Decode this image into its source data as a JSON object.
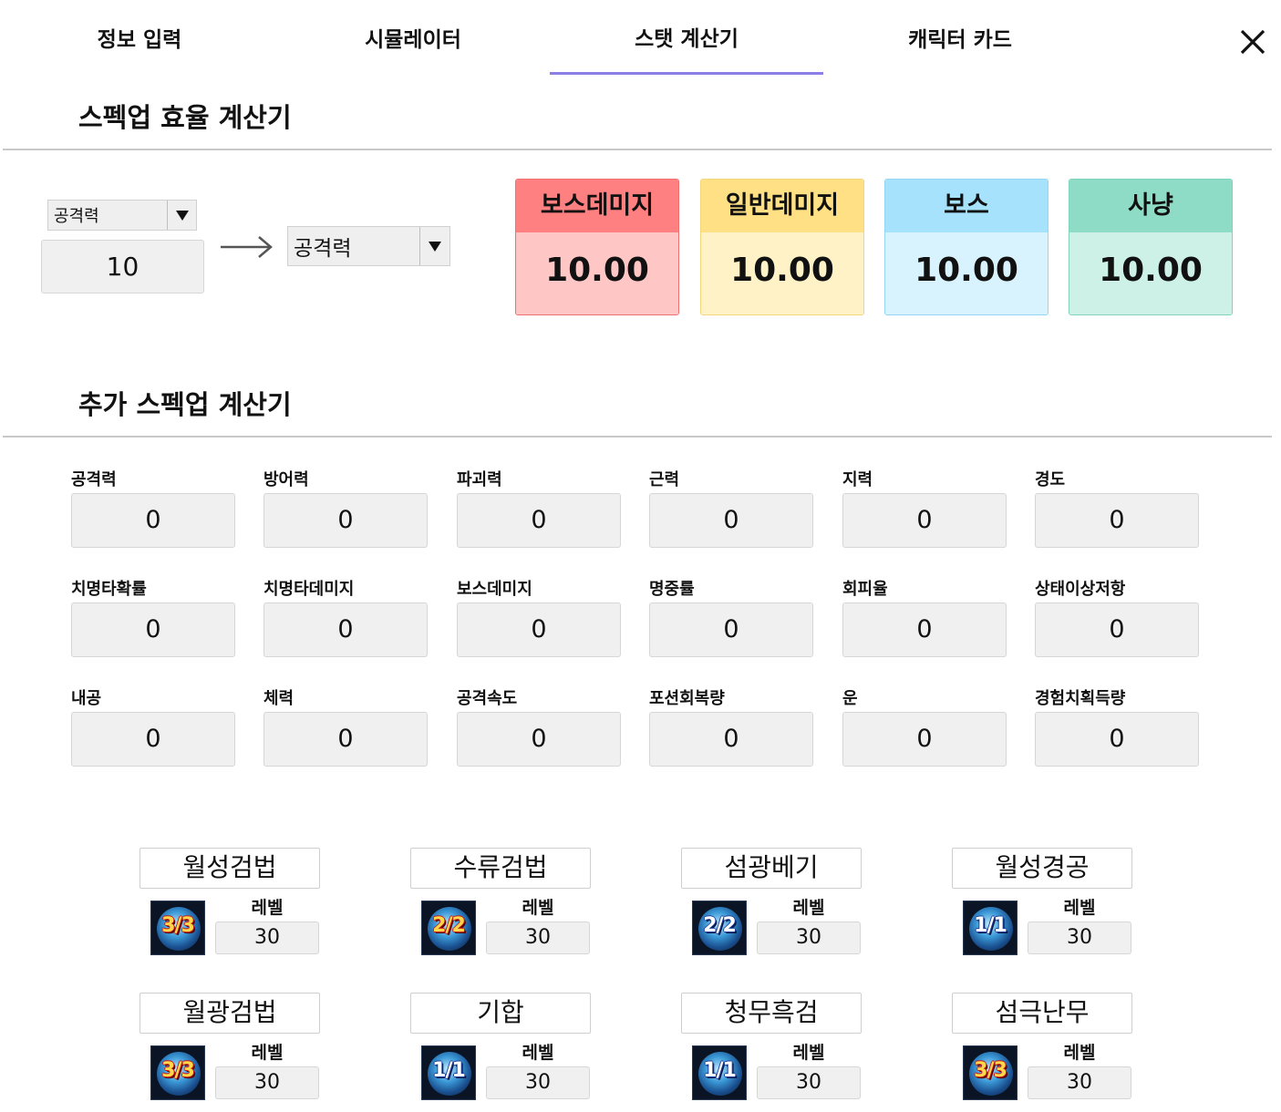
{
  "tabs": [
    {
      "label": "정보 입력"
    },
    {
      "label": "시뮬레이터"
    },
    {
      "label": "스탯 계산기"
    },
    {
      "label": "캐릭터 카드"
    }
  ],
  "active_tab": "스탯 계산기",
  "efficiency": {
    "title": "스펙업 효율 계산기",
    "from_stat": "공격력",
    "amount": "10",
    "to_stat": "공격력",
    "results": [
      {
        "label": "보스데미지",
        "value": "10.00"
      },
      {
        "label": "일반데미지",
        "value": "10.00"
      },
      {
        "label": "보스",
        "value": "10.00"
      },
      {
        "label": "사냥",
        "value": "10.00"
      }
    ]
  },
  "additional": {
    "title": "추가 스펙업 계산기",
    "stats": [
      {
        "label": "공격력",
        "value": "0"
      },
      {
        "label": "방어력",
        "value": "0"
      },
      {
        "label": "파괴력",
        "value": "0"
      },
      {
        "label": "근력",
        "value": "0"
      },
      {
        "label": "지력",
        "value": "0"
      },
      {
        "label": "경도",
        "value": "0"
      },
      {
        "label": "치명타확률",
        "value": "0"
      },
      {
        "label": "치명타데미지",
        "value": "0"
      },
      {
        "label": "보스데미지",
        "value": "0"
      },
      {
        "label": "명중률",
        "value": "0"
      },
      {
        "label": "회피율",
        "value": "0"
      },
      {
        "label": "상태이상저항",
        "value": "0"
      },
      {
        "label": "내공",
        "value": "0"
      },
      {
        "label": "체력",
        "value": "0"
      },
      {
        "label": "공격속도",
        "value": "0"
      },
      {
        "label": "포션회복량",
        "value": "0"
      },
      {
        "label": "운",
        "value": "0"
      },
      {
        "label": "경험치획득량",
        "value": "0"
      }
    ]
  },
  "skills": [
    {
      "name": "월성검법",
      "icon_text": "3/3",
      "level_label": "레벨",
      "level": "30"
    },
    {
      "name": "수류검법",
      "icon_text": "2/2",
      "level_label": "레벨",
      "level": "30"
    },
    {
      "name": "섬광베기",
      "icon_text": "2/2",
      "level_label": "레벨",
      "level": "30"
    },
    {
      "name": "월성경공",
      "icon_text": "1/1",
      "level_label": "레벨",
      "level": "30"
    },
    {
      "name": "월광검법",
      "icon_text": "3/3",
      "level_label": "레벨",
      "level": "30"
    },
    {
      "name": "기합",
      "icon_text": "1/1",
      "level_label": "레벨",
      "level": "30"
    },
    {
      "name": "청무흑검",
      "icon_text": "1/1",
      "level_label": "레벨",
      "level": "30"
    },
    {
      "name": "섬극난무",
      "icon_text": "3/3",
      "level_label": "레벨",
      "level": "30"
    }
  ],
  "colors": {
    "accent": "#8b7ee6",
    "boss_damage_head": "#ff8080",
    "boss_damage_body": "#ffc6c6",
    "normal_damage_head": "#ffe084",
    "normal_damage_body": "#fff2c6",
    "boss_head": "#a6e2fc",
    "boss_body": "#d8f3fe",
    "hunt_head": "#8fdcc6",
    "hunt_body": "#cdf1e6"
  }
}
